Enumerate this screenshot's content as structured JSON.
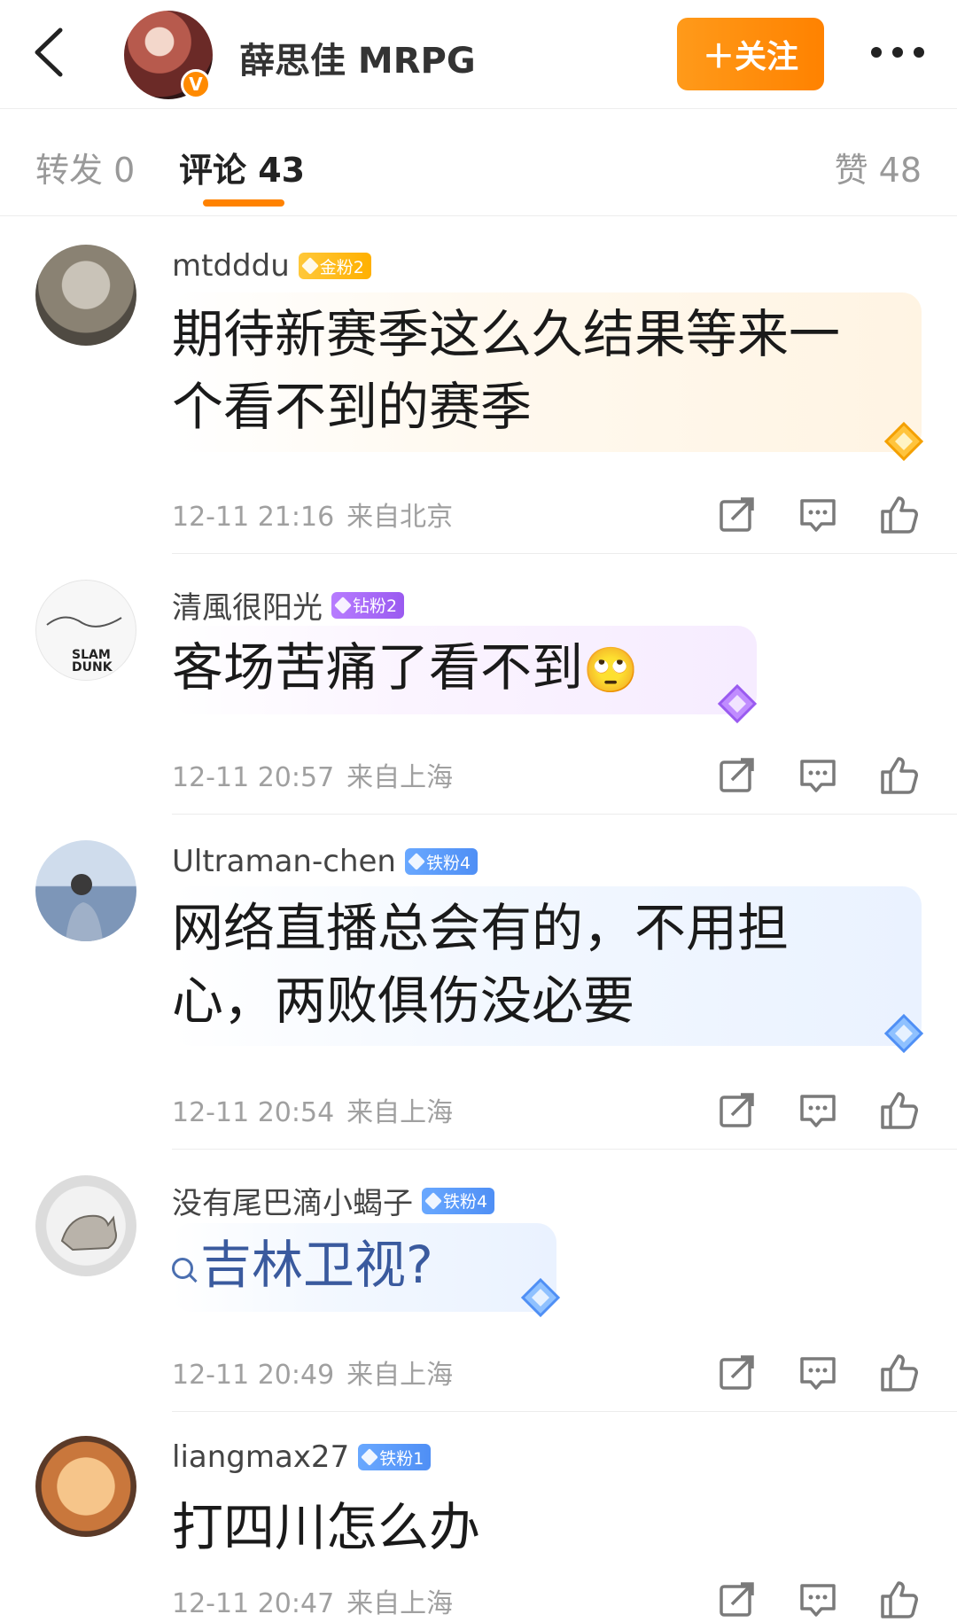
{
  "header": {
    "author_name": "薛思佳 MRPG",
    "verified_mark": "V",
    "follow_label": "＋关注"
  },
  "tabs": {
    "repost": "转发 0",
    "comment": "评论 43",
    "like": "赞 48"
  },
  "comments": [
    {
      "user": "mtdddu",
      "badge": "金粉2",
      "badge_kind": "gold",
      "text": "期待新赛季这么久结果等来一个看不到的赛季",
      "time": "12-11 21:16",
      "location": "来自北京"
    },
    {
      "user": "清風很阳光",
      "badge": "钻粉2",
      "badge_kind": "diamond",
      "text": "客场苦痛了看不到",
      "emoji": "🙄",
      "time": "12-11 20:57",
      "location": "来自上海"
    },
    {
      "user": "Ultraman-chen",
      "badge": "铁粉4",
      "badge_kind": "iron",
      "text": "网络直播总会有的，不用担心，两败俱伤没必要",
      "time": "12-11 20:54",
      "location": "来自上海"
    },
    {
      "user": "没有尾巴滴小蝎子",
      "badge": "铁粉4",
      "badge_kind": "iron",
      "text": "吉林卫视?",
      "time": "12-11 20:49",
      "location": "来自上海"
    },
    {
      "user": "liangmax27",
      "badge": "铁粉1",
      "badge_kind": "iron",
      "text": "打四川怎么办",
      "time": "12-11 20:47",
      "location": "来自上海"
    }
  ],
  "icons": {
    "back": "chevron-left-icon",
    "more": "more-dots-icon",
    "share": "share-icon",
    "reply": "comment-icon",
    "like": "thumbs-up-icon"
  },
  "colors": {
    "accent": "#ff8200",
    "gold_badge": "#ffb000",
    "diamond_badge": "#9a5af0",
    "iron_badge": "#4f8ff5",
    "link": "#3a5a9e"
  }
}
